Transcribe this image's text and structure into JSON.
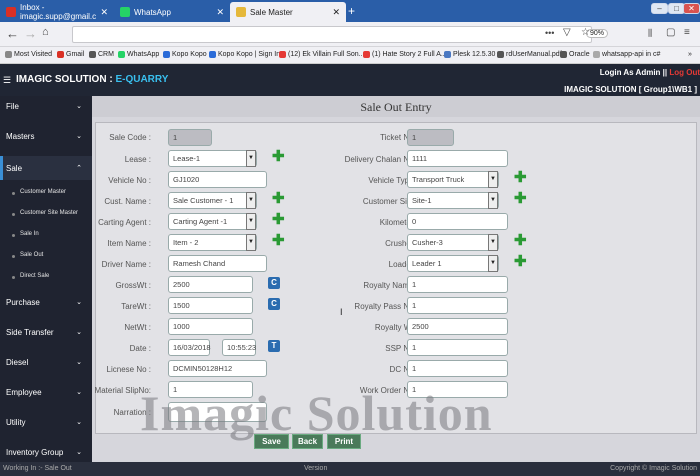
{
  "browser": {
    "tabs": [
      {
        "title": "Inbox - imagic.supp@gmail.c",
        "active": false,
        "color": "#d93025"
      },
      {
        "title": "WhatsApp",
        "active": false,
        "color": "#25d366"
      },
      {
        "title": "Sale Master",
        "active": true,
        "color": "#e5b83a"
      }
    ],
    "new_tab": "+",
    "window_buttons": [
      "–",
      "□",
      "✕"
    ],
    "url": "",
    "zoom": "90%",
    "bookmarks": [
      {
        "label": "Most Visited",
        "color": "#888888"
      },
      {
        "label": "Gmail",
        "color": "#d93025"
      },
      {
        "label": "CRM",
        "color": "#555555"
      },
      {
        "label": "WhatsApp",
        "color": "#25d366"
      },
      {
        "label": "Kopo Kopo",
        "color": "#2a6bd8"
      },
      {
        "label": "Kopo Kopo | Sign In",
        "color": "#2a6bd8"
      },
      {
        "label": "(12) Ek Villain Full Son...",
        "color": "#e53935"
      },
      {
        "label": "(1) Hate Story 2 Full A...",
        "color": "#e53935"
      },
      {
        "label": "Plesk 12.5.30",
        "color": "#4a78c2"
      },
      {
        "label": "rdUserManual.pdf",
        "color": "#555555"
      },
      {
        "label": "Oracle",
        "color": "#555555"
      },
      {
        "label": "whatsapp-api in c#",
        "color": "#aaaaaa"
      }
    ],
    "more_bookmarks": "»"
  },
  "app": {
    "brand_main": "IMAGIC SOLUTION : ",
    "brand_sub": "E-QUARRY",
    "login_text": "Login As Admin || ",
    "logout_text": "Log Out",
    "company": "IMAGIC SOLUTION [ Group1\\WB1 ]"
  },
  "sidebar": {
    "items": [
      "File",
      "Masters",
      "Sale",
      "Purchase",
      "Side Transfer",
      "Diesel",
      "Employee",
      "Utility",
      "Inventory Group"
    ],
    "sale_sub": [
      "Customer Master",
      "Customer Site Master",
      "Sale In",
      "Sale Out",
      "Direct Sale"
    ]
  },
  "form": {
    "title": "Sale Out Entry",
    "sale_code_label": "Sale Code :",
    "sale_code": "1",
    "lease_label": "Lease :",
    "lease": "Lease-1",
    "vehicle_no_label": "Vehicle No :",
    "vehicle_no": "GJ1020",
    "cust_name_label": "Cust. Name :",
    "cust_name": "Sale Customer - 1",
    "carting_agent_label": "Carting Agent :",
    "carting_agent": "Carting Agent -1",
    "item_name_label": "Item Name :",
    "item_name": "Item - 2",
    "driver_name_label": "Driver Name :",
    "driver_name": "Ramesh Chand",
    "gross_wt_label": "GrossWt :",
    "gross_wt": "2500",
    "tare_wt_label": "TareWt :",
    "tare_wt": "1500",
    "net_wt_label": "NetWt :",
    "net_wt": "1000",
    "date_label": "Date :",
    "date": "16/03/2018",
    "time": "10:55:23",
    "licnese_label": "Licnese No :",
    "licnese": "DCMIN50128H12",
    "material_slip_label": "Material SlipNo:",
    "material_slip": "1",
    "narration_label": "Narration :",
    "narration": "",
    "ticket_no_label": "Ticket No :",
    "ticket_no": "1",
    "delivery_chalan_label": "Delivery Chalan No :",
    "delivery_chalan": "1111",
    "vehicle_type_label": "Vehicle Type :",
    "vehicle_type": "Transport Truck",
    "customer_site_label": "Customer Site :",
    "customer_site": "Site-1",
    "kilometer_label": "Kilometer :",
    "kilometer": "0",
    "crusher_label": "Crusher :",
    "crusher": "Cusher-3",
    "loader_label": "Loader :",
    "loader": "Leader 1",
    "royalty_name_label": "Royalty Name :",
    "royalty_name": "1",
    "royalty_pass_label": "Royalty Pass No :",
    "royalty_pass": "1",
    "royalty_wt_label": "Royalty Wt :",
    "royalty_wt": "2500",
    "ssp_no_label": "SSP No :",
    "ssp_no": "1",
    "dc_no_label": "DC No :",
    "dc_no": "1",
    "work_order_label": "Work Order No :",
    "work_order": "1",
    "c_btn": "C",
    "t_btn": "T",
    "save": "Save",
    "back": "Back",
    "print": "Print"
  },
  "watermark": "Imagic Solution",
  "footer": {
    "left": "Working In :- Sale Out",
    "center": "Version",
    "right": "Copyright © Imagic Solution"
  }
}
